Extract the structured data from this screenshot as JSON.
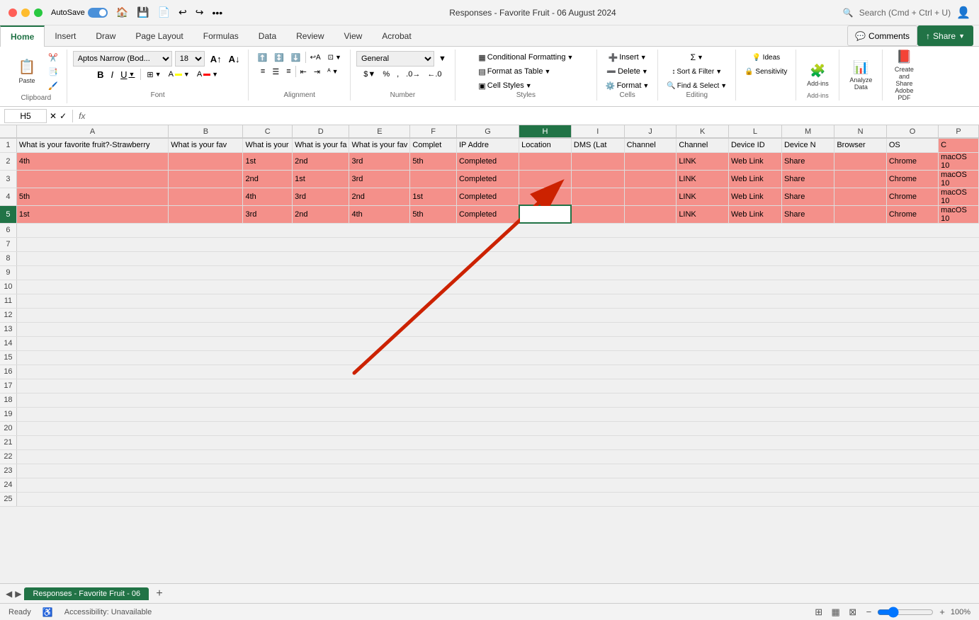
{
  "titlebar": {
    "autosave_label": "AutoSave",
    "title": "Responses - Favorite Fruit - 06 August 2024",
    "search_placeholder": "Search (Cmd + Ctrl + U)"
  },
  "ribbon": {
    "tabs": [
      "Home",
      "Insert",
      "Draw",
      "Page Layout",
      "Formulas",
      "Data",
      "Review",
      "View",
      "Acrobat"
    ],
    "active_tab": "Home",
    "font_name": "Aptos Narrow (Bod...",
    "font_size": "18",
    "format_type": "General",
    "groups": {
      "clipboard_label": "Clipboard",
      "font_label": "Font",
      "alignment_label": "Alignment",
      "number_label": "Number",
      "styles_label": "Styles",
      "cells_label": "Cells",
      "editing_label": "Editing",
      "addins_label": "Add-ins",
      "analyze_label": "Analyze Data",
      "adobe_label": "Create and Share Adobe PDF"
    },
    "styles": {
      "conditional_formatting": "Conditional Formatting",
      "format_as_table": "Format as Table",
      "cell_styles": "Cell Styles",
      "format": "Format"
    },
    "cells": {
      "insert": "Insert",
      "delete": "Delete",
      "format": "Format"
    },
    "editing": {
      "sum": "Σ",
      "sort_filter": "Sort & Filter",
      "find_select": "Find & Select"
    }
  },
  "toolbar_right": {
    "comments_label": "Comments",
    "share_label": "Share"
  },
  "formula_bar": {
    "cell_ref": "H5",
    "fx_label": "fx",
    "formula_value": ""
  },
  "columns": {
    "headers": [
      "A",
      "B",
      "C",
      "D",
      "E",
      "F",
      "G",
      "H",
      "I",
      "J",
      "K",
      "L",
      "M",
      "N",
      "O",
      "P"
    ],
    "labels": [
      "A",
      "B",
      "C",
      "D",
      "E",
      "F",
      "G",
      "H",
      "I",
      "J",
      "K",
      "L",
      "M",
      "N",
      "O",
      "P"
    ]
  },
  "rows": {
    "header_row": {
      "A": "What is your favorite fruit?-Strawberry",
      "B": "What is your fav",
      "C": "What is your",
      "D": "What is your fa",
      "E": "What is your fav",
      "F": "Complet",
      "G": "IP Addre",
      "H": "Location",
      "I": "DMS (Lat",
      "J": "Channel",
      "K": "Channel",
      "L": "Device ID",
      "M": "Device N",
      "N": "Browser",
      "O": "OS",
      "P": "C"
    },
    "row2": {
      "num": "2",
      "A": "4th",
      "B": "",
      "C": "1st",
      "D": "2nd",
      "E": "3rd",
      "F": "5th",
      "G": "Completed",
      "H": "",
      "I": "",
      "J": "",
      "K": "LINK",
      "L": "Web Link",
      "M": "Share",
      "N": "",
      "O": "Chrome",
      "P": "macOS 10"
    },
    "row3": {
      "num": "3",
      "A": "",
      "B": "",
      "C": "2nd",
      "D": "1st",
      "E": "3rd",
      "F": "",
      "G": "Completed",
      "H": "",
      "I": "",
      "J": "",
      "K": "LINK",
      "L": "Web Link",
      "M": "Share",
      "N": "",
      "O": "Chrome",
      "P": "macOS 10"
    },
    "row4": {
      "num": "4",
      "A": "5th",
      "B": "",
      "C": "4th",
      "D": "3rd",
      "E": "2nd",
      "F": "1st",
      "G": "Completed",
      "H": "",
      "I": "",
      "J": "",
      "K": "LINK",
      "L": "Web Link",
      "M": "Share",
      "N": "",
      "O": "Chrome",
      "P": "macOS 10"
    },
    "row5": {
      "num": "5",
      "A": "1st",
      "B": "",
      "C": "3rd",
      "D": "2nd",
      "E": "4th",
      "F": "5th",
      "G": "Completed",
      "H": "",
      "I": "",
      "J": "",
      "K": "LINK",
      "L": "Web Link",
      "M": "Share",
      "N": "",
      "O": "Chrome",
      "P": "macOS 10"
    },
    "empty_rows": [
      "6",
      "7",
      "8",
      "9",
      "10",
      "11",
      "12",
      "13",
      "14",
      "15",
      "16",
      "17",
      "18",
      "19",
      "20",
      "21",
      "22",
      "23",
      "24",
      "25"
    ]
  },
  "sheet_tabs": {
    "active_tab": "Responses - Favorite Fruit - 06",
    "add_btn_label": "+"
  },
  "status_bar": {
    "ready_label": "Ready",
    "accessibility_label": "Accessibility: Unavailable",
    "zoom_level": "100%",
    "zoom_minus": "−",
    "zoom_plus": "+"
  },
  "colors": {
    "green_accent": "#217346",
    "pink_row": "#f4908a",
    "selected_cell_border": "#217346",
    "header_bg": "#f3f3f3"
  }
}
